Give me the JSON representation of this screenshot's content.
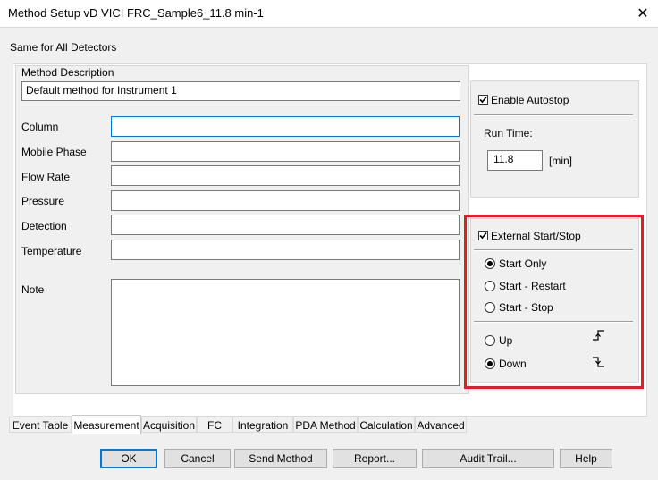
{
  "window": {
    "title": "Method Setup vD VICI FRC_Sample6_11.8 min-1",
    "close_glyph": "✕"
  },
  "header": {
    "same_for_all": "Same for All Detectors"
  },
  "method": {
    "description_label": "Method Description",
    "description_value": "Default method for Instrument 1",
    "fields": [
      {
        "label": "Column",
        "value": ""
      },
      {
        "label": "Mobile Phase",
        "value": ""
      },
      {
        "label": "Flow Rate",
        "value": ""
      },
      {
        "label": "Pressure",
        "value": ""
      },
      {
        "label": "Detection",
        "value": ""
      },
      {
        "label": "Temperature",
        "value": ""
      }
    ],
    "note_label": "Note",
    "note_value": ""
  },
  "autostop": {
    "checkbox_label": "Enable Autostop",
    "checked": true,
    "run_time_label": "Run Time:",
    "run_time_value": "11.8",
    "unit": "[min]"
  },
  "external": {
    "checkbox_label": "External Start/Stop",
    "checked": true,
    "modes": [
      {
        "label": "Start Only",
        "selected": true
      },
      {
        "label": "Start - Restart",
        "selected": false
      },
      {
        "label": "Start - Stop",
        "selected": false
      }
    ],
    "edges": [
      {
        "label": "Up",
        "selected": false,
        "icon": "rising-edge-icon"
      },
      {
        "label": "Down",
        "selected": true,
        "icon": "falling-edge-icon"
      }
    ],
    "highlight_color": "#e21c2a"
  },
  "tabs": [
    {
      "label": "Event Table",
      "active": false
    },
    {
      "label": "Measurement",
      "active": true
    },
    {
      "label": "Acquisition",
      "active": false
    },
    {
      "label": "FC",
      "active": false
    },
    {
      "label": "Integration",
      "active": false
    },
    {
      "label": "PDA Method",
      "active": false
    },
    {
      "label": "Calculation",
      "active": false
    },
    {
      "label": "Advanced",
      "active": false
    }
  ],
  "buttons": {
    "ok": "OK",
    "cancel": "Cancel",
    "send_method": "Send Method",
    "report": "Report...",
    "audit_trail": "Audit Trail...",
    "help": "Help"
  }
}
